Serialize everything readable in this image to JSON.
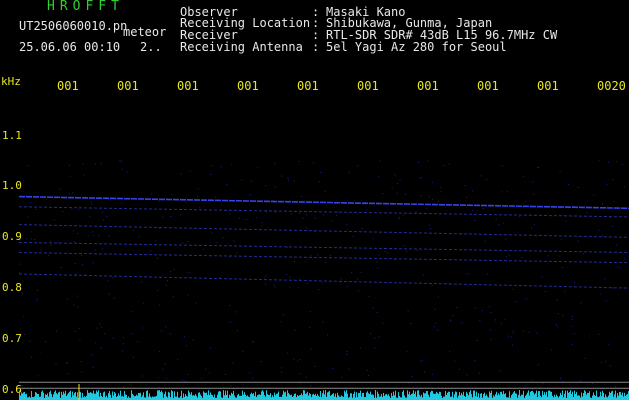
{
  "header": {
    "title": "HROFFT",
    "filename": "UT2506060010.pn",
    "mode": "meteor",
    "datetime": "25.06.06 00:10",
    "count": "2..",
    "fields": [
      {
        "label": "Observer",
        "value": "Masaki Kano"
      },
      {
        "label": "Receiving Location",
        "value": "Shibukawa, Gunma, Japan"
      },
      {
        "label": "Receiver",
        "value": "RTL-SDR SDR# 43dB L15 96.7MHz CW"
      },
      {
        "label": "Receiving Antenna",
        "value": "5el Yagi Az 280 for Seoul"
      }
    ],
    "separator": ":"
  },
  "colors": {
    "background": "#000000",
    "header_green": "#2fd02f",
    "text_white": "#e8e8e8",
    "axis_yellow": "#e8e820",
    "signal_blue": "#3a48ff",
    "level_cyan": "#20c8e0"
  },
  "chart_data": {
    "type": "heatmap",
    "ylabel": "kHz",
    "y_ticks": [
      "1.1",
      "1.0",
      "0.9",
      "0.8",
      "0.7",
      "0.6"
    ],
    "x_ticks": [
      "001",
      "001",
      "001",
      "001",
      "001",
      "001",
      "001",
      "001",
      "001",
      "0020"
    ],
    "ylim": [
      0.58,
      1.17
    ],
    "traces_khz": [
      {
        "start": 0.98,
        "end": 0.957
      },
      {
        "start": 0.96,
        "end": 0.94
      },
      {
        "start": 0.925,
        "end": 0.9
      },
      {
        "start": 0.89,
        "end": 0.87
      },
      {
        "start": 0.87,
        "end": 0.85
      },
      {
        "start": 0.828,
        "end": 0.8
      }
    ],
    "reference_lines_khz": [
      0.615,
      0.603
    ]
  }
}
